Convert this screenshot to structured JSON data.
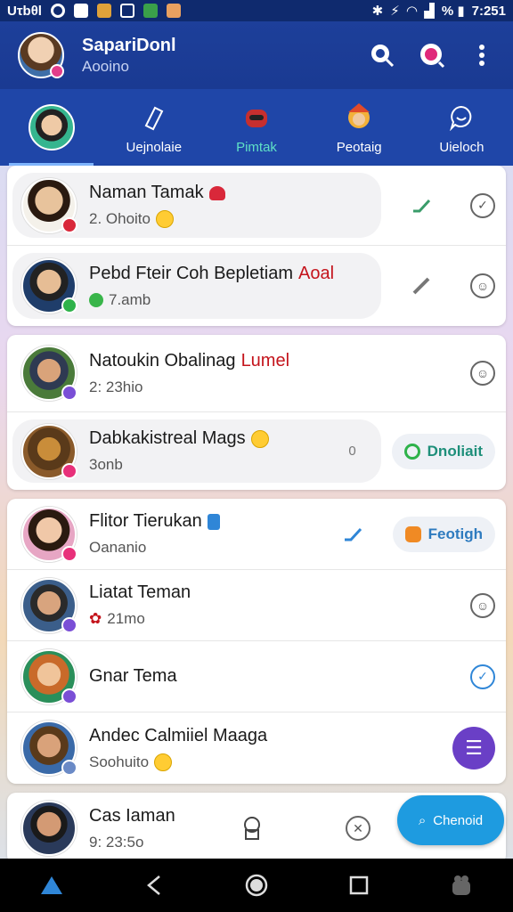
{
  "status_bar": {
    "carrier": "Uτbθl",
    "battery": "% ▮",
    "time": "7:251"
  },
  "header": {
    "title": "SapariDonl",
    "subtitle": "Aooino"
  },
  "tabs": [
    {
      "label": ""
    },
    {
      "label": "Uejnolaie"
    },
    {
      "label": "Pimtak"
    },
    {
      "label": "Peotaig"
    },
    {
      "label": "Uieloch"
    }
  ],
  "chats": [
    {
      "name": "Naman Tamak",
      "sub": "2. Ohoito",
      "status": "check"
    },
    {
      "name": "Pebd Fteir Coh Bepletiam",
      "name_red": "Aoal",
      "sub": "7.amb",
      "status": "check"
    },
    {
      "name": "Natoukin Obalinag",
      "name_red": "Lumel",
      "sub": "2: 23hio",
      "status": "check"
    },
    {
      "name": "Dabkakistreal Mags",
      "sub": "3onb",
      "count": "0",
      "action": "Dnoliait"
    },
    {
      "name": "Flitor Tierukan",
      "sub": "Oananio",
      "action": "Feotigh"
    },
    {
      "name": "Liatat Teman",
      "sub": "21mo",
      "status": "check"
    },
    {
      "name": "Gnar Tema",
      "sub": "",
      "status": "check-blue"
    },
    {
      "name": "Andec Calmiiel Maaga",
      "sub": "Soohuito",
      "status": "menu"
    },
    {
      "name": "Cas Iaman",
      "sub": "9: 23:5o"
    }
  ],
  "cta": {
    "label": "Chenoid"
  },
  "colors": {
    "header": "#1d3f9a",
    "tabs": "#1f46a8",
    "accent": "#1e9be0",
    "fab": "#6a3fc6"
  }
}
